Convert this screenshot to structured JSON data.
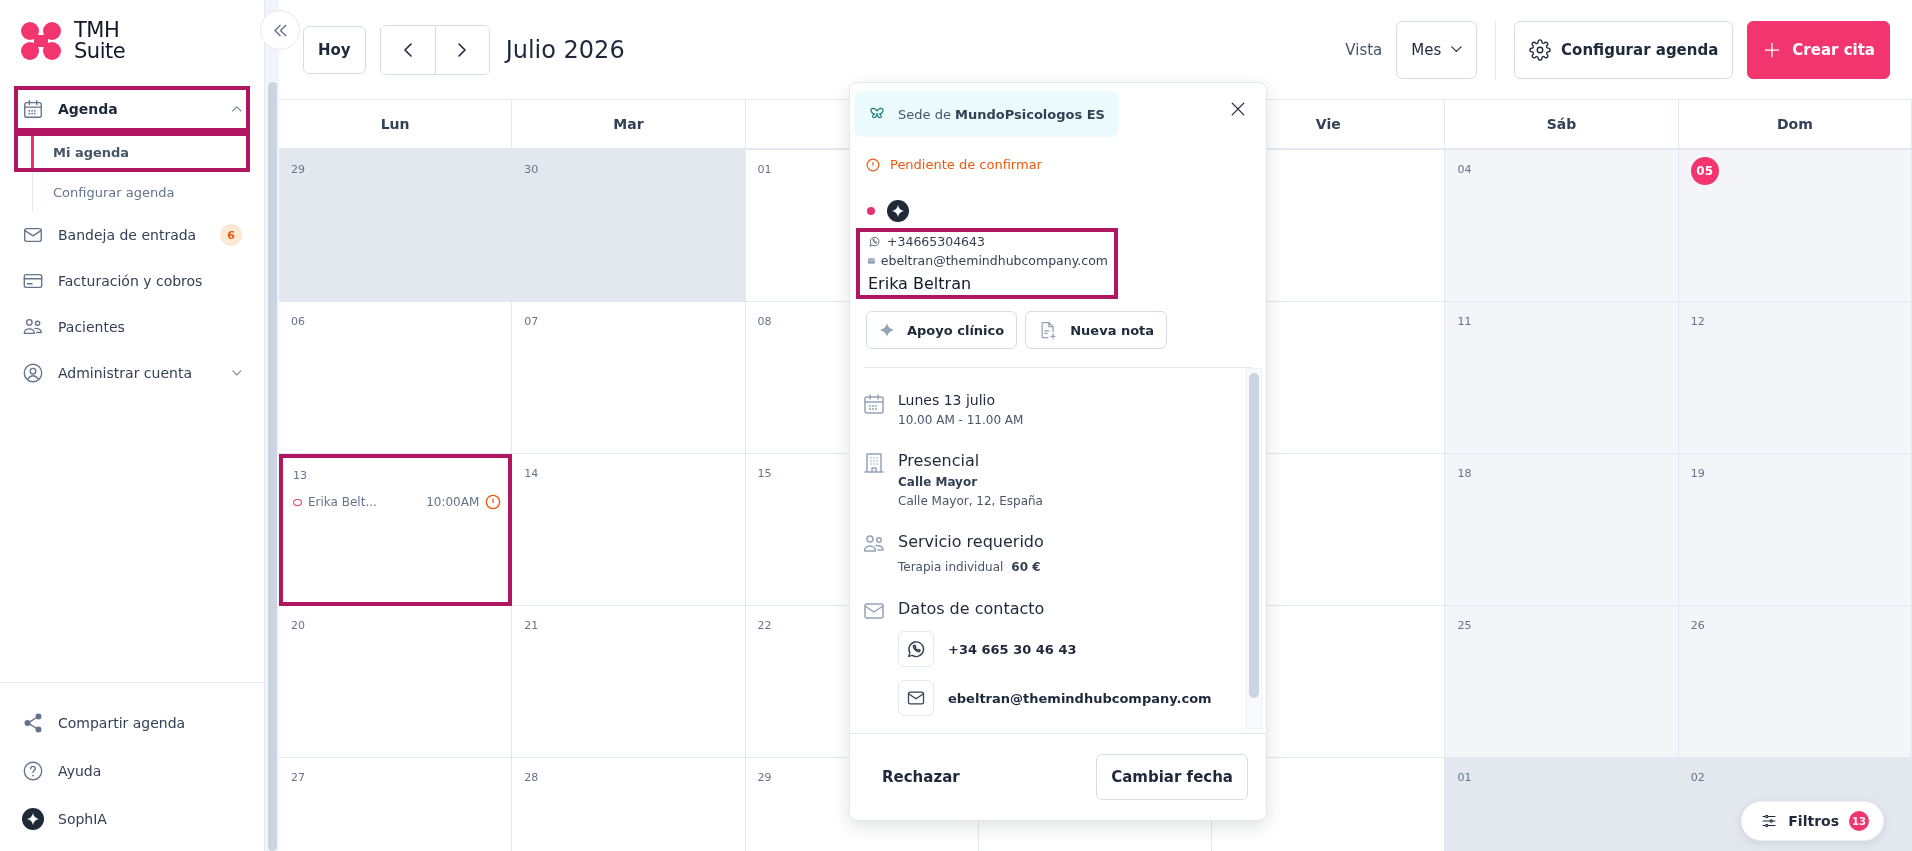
{
  "sidebar": {
    "logo": {
      "line_1": "TMH",
      "line_2": "Suite"
    },
    "nav": [
      {
        "kind": "group",
        "label": "Agenda",
        "expanded": true,
        "highlighted": true,
        "children": [
          {
            "label": "Mi agenda",
            "selected": true,
            "highlighted": true
          },
          {
            "label": "Configurar agenda",
            "selected": false,
            "highlighted": false
          }
        ]
      },
      {
        "kind": "link",
        "label": "Bandeja de entrada",
        "badge": "6"
      },
      {
        "kind": "link",
        "label": "Facturación y cobros"
      },
      {
        "kind": "link",
        "label": "Pacientes"
      },
      {
        "kind": "group",
        "label": "Administrar cuenta",
        "expanded": false,
        "highlighted": false
      }
    ],
    "footer": [
      {
        "label": "Compartir agenda"
      },
      {
        "label": "Ayuda"
      },
      {
        "label": "SophIA"
      }
    ]
  },
  "toolbar": {
    "today_button": "Hoy",
    "title": "Julio 2026",
    "view_label": "Vista",
    "view_select": "Mes",
    "configure_button": "Configurar agenda",
    "create_button": "Crear cita"
  },
  "calendar": {
    "columns": [
      {
        "label": "Lun"
      },
      {
        "label": "Mar"
      },
      {},
      {},
      {
        "label": "Vie"
      },
      {
        "label": "Sáb"
      },
      {
        "label": "Dom"
      }
    ],
    "weeks": [
      {
        "days": [
          {
            "date": "29",
            "kind": "other_month"
          },
          {
            "date": "30",
            "kind": "other_month"
          },
          {
            "date": "01",
            "kind": "weekday"
          },
          {
            "kind": "weekday"
          },
          {
            "kind": "weekday"
          },
          {
            "date": "04",
            "kind": "weekend"
          },
          {
            "date": "05",
            "kind": "weekend",
            "today": true
          }
        ]
      },
      {
        "days": [
          {
            "date": "06",
            "kind": "weekday"
          },
          {
            "date": "07",
            "kind": "weekday"
          },
          {
            "date": "08",
            "kind": "weekday"
          },
          {
            "kind": "weekday"
          },
          {
            "kind": "weekday"
          },
          {
            "date": "11",
            "kind": "weekend"
          },
          {
            "date": "12",
            "kind": "weekend"
          }
        ]
      },
      {
        "days": [
          {
            "date": "13",
            "kind": "weekday",
            "highlighted": true,
            "events": [
              {
                "name": "Erika Belt...",
                "time": "10:00AM",
                "kind": "pending"
              }
            ]
          },
          {
            "date": "14",
            "kind": "weekday"
          },
          {
            "date": "15",
            "kind": "weekday"
          },
          {
            "kind": "weekday"
          },
          {
            "kind": "weekday"
          },
          {
            "date": "18",
            "kind": "weekend"
          },
          {
            "date": "19",
            "kind": "weekend"
          }
        ]
      },
      {
        "days": [
          {
            "date": "20",
            "kind": "weekday"
          },
          {
            "date": "21",
            "kind": "weekday"
          },
          {
            "date": "22",
            "kind": "weekday"
          },
          {
            "kind": "weekday"
          },
          {
            "kind": "weekday"
          },
          {
            "date": "25",
            "kind": "weekend"
          },
          {
            "date": "26",
            "kind": "weekend"
          }
        ]
      },
      {
        "days": [
          {
            "date": "27",
            "kind": "weekday"
          },
          {
            "date": "28",
            "kind": "weekday"
          },
          {
            "date": "29",
            "kind": "weekday"
          },
          {
            "kind": "weekday"
          },
          {
            "kind": "weekday"
          },
          {
            "date": "01",
            "kind": "other_month"
          },
          {
            "date": "02",
            "kind": "other_month"
          }
        ]
      }
    ]
  },
  "popup": {
    "source": "Sede de **MundoPsicologos ES**",
    "status": {
      "kind": "pending",
      "label": "Pendiente de confirmar"
    },
    "contact": {
      "phone": "+34665304643",
      "email": "ebeltran@themindhubcompany.com",
      "name": "Erika Beltran",
      "highlighted": true
    },
    "actions": [
      "Apoyo clínico",
      "Nueva nota"
    ],
    "date": {
      "title": "Lunes 13 julio",
      "time": "10.00 AM - 11.00 AM"
    },
    "location": {
      "title": "Presencial",
      "place": "Calle Mayor",
      "address": "Calle Mayor, 12, España"
    },
    "service": {
      "title": "Servicio requerido",
      "name": "Terapia individual",
      "price": "60 €"
    },
    "contact_data": {
      "title": "Datos de contacto",
      "phone": "+34 665 30 46 43",
      "email": "ebeltran@themindhubcompany.com"
    },
    "footer": {
      "reject_button": "Rechazar",
      "reschedule_button": "Cambiar fecha"
    }
  },
  "filters": {
    "label": "Filtros",
    "count": "13"
  }
}
